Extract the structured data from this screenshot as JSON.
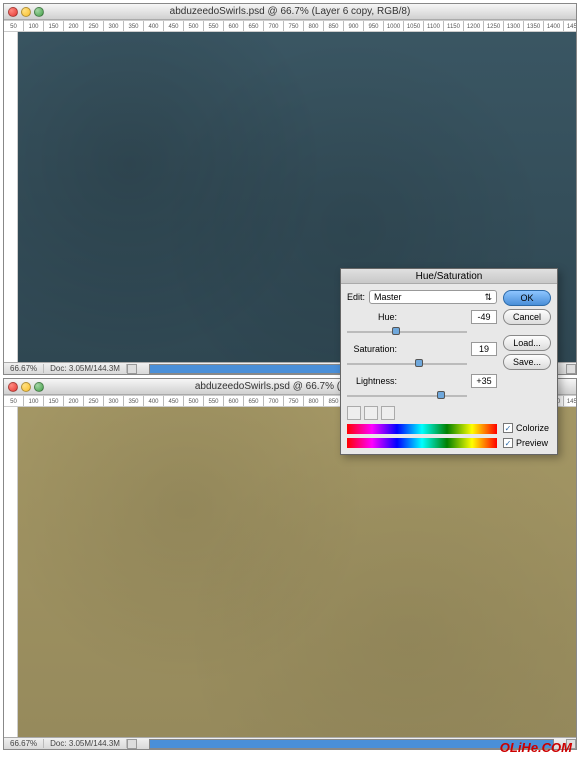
{
  "window1": {
    "title": "abduzeedoSwirls.psd @ 66.7% (Layer 6 copy, RGB/8)",
    "zoom": "66.67%",
    "doc_info": "Doc: 3.05M/144.3M"
  },
  "window2": {
    "title": "abduzeedoSwirls.psd @ 66.7% (Hue/Satur",
    "zoom": "66.67%",
    "doc_info": "Doc: 3.05M/144.3M"
  },
  "dialog": {
    "title": "Hue/Saturation",
    "edit_label": "Edit:",
    "edit_value": "Master",
    "hue_label": "Hue:",
    "hue_value": "-49",
    "sat_label": "Saturation:",
    "sat_value": "19",
    "light_label": "Lightness:",
    "light_value": "+35",
    "ok": "OK",
    "cancel": "Cancel",
    "load": "Load...",
    "save": "Save...",
    "colorize": "Colorize",
    "preview": "Preview"
  },
  "watermark": "OLiHe.COM",
  "chart_data": null
}
